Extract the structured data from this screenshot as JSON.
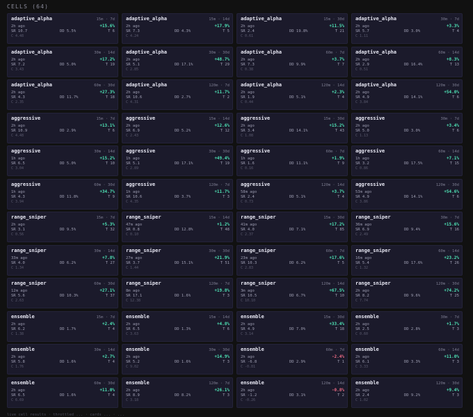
{
  "header": {
    "title": "CELLS (64)"
  },
  "footer": {
    "text": "live cell results · throttled ... · cards ... · ..."
  },
  "cells": [
    {
      "name": "adaptive_alpha",
      "tf": "15m · 7d",
      "ago": "2h ago",
      "ret": "+15.6%",
      "sr": "SR 10.7",
      "dd": "DD 5.5%",
      "t": "T 6",
      "c": "C 4.48",
      "sign": "pos"
    },
    {
      "name": "adaptive_alpha",
      "tf": "15m · 14d",
      "ago": "2h ago",
      "ret": "+17.9%",
      "sr": "SR 7.3",
      "dd": "DD 4.3%",
      "t": "T 5",
      "c": "C 4.24",
      "sign": "pos"
    },
    {
      "name": "adaptive_alpha",
      "tf": "15m · 30d",
      "ago": "2h ago",
      "ret": "+11.5%",
      "sr": "SR 2.4",
      "dd": "DD 19.8%",
      "t": "T 21",
      "c": "C 0.61",
      "sign": "pos"
    },
    {
      "name": "adaptive_alpha",
      "tf": "30m · 7d",
      "ago": "2h ago",
      "ret": "+3.3%",
      "sr": "SR 5.7",
      "dd": "DD 3.0%",
      "t": "T 4",
      "c": "C 1.11",
      "sign": "pos"
    },
    {
      "name": "adaptive_alpha",
      "tf": "30m · 14d",
      "ago": "2h ago",
      "ret": "+17.2%",
      "sr": "SR 7.2",
      "dd": "DD 5.0%",
      "t": "T 19",
      "c": "C 3.43",
      "sign": "pos"
    },
    {
      "name": "adaptive_alpha",
      "tf": "30m · 30d",
      "ago": "2h ago",
      "ret": "+48.7%",
      "sr": "SR 5.1",
      "dd": "DD 17.1%",
      "t": "T 29",
      "c": "C 2.85",
      "sign": "pos"
    },
    {
      "name": "adaptive_alpha",
      "tf": "60m · 7d",
      "ago": "2h ago",
      "ret": "+3.7%",
      "sr": "SR 7.3",
      "dd": "DD 9.9%",
      "t": "T 7",
      "c": "C 0.38",
      "sign": "pos"
    },
    {
      "name": "adaptive_alpha",
      "tf": "60m · 14d",
      "ago": "2h ago",
      "ret": "+8.3%",
      "sr": "SR 2.9",
      "dd": "DD 16.4%",
      "t": "T 13",
      "c": "C 0.51",
      "sign": "pos"
    },
    {
      "name": "adaptive_alpha",
      "tf": "60m · 30d",
      "ago": "2h ago",
      "ret": "+27.3%",
      "sr": "SR 4.3",
      "dd": "DD 11.7%",
      "t": "T 18",
      "c": "C 2.35",
      "sign": "pos"
    },
    {
      "name": "adaptive_alpha",
      "tf": "120m · 7d",
      "ago": "2h ago",
      "ret": "+11.7%",
      "sr": "SR 10.6",
      "dd": "DD 2.7%",
      "t": "T 2",
      "c": "C 4.31",
      "sign": "pos"
    },
    {
      "name": "adaptive_alpha",
      "tf": "120m · 14d",
      "ago": "2h ago",
      "ret": "+2.3%",
      "sr": "SR 1.9",
      "dd": "DD 5.1%",
      "t": "T 4",
      "c": "C 0.44",
      "sign": "pos"
    },
    {
      "name": "adaptive_alpha",
      "tf": "120m · 30d",
      "ago": "2h ago",
      "ret": "+54.0%",
      "sr": "SR 4.9",
      "dd": "DD 14.1%",
      "t": "T 6",
      "c": "C 3.84",
      "sign": "pos"
    },
    {
      "name": "aggressive",
      "tf": "15m · 7d",
      "ago": "2h ago",
      "ret": "+13.1%",
      "sr": "SR 10.9",
      "dd": "DD 2.9%",
      "t": "T 6",
      "c": "C 4.48",
      "sign": "pos"
    },
    {
      "name": "aggressive",
      "tf": "15m · 14d",
      "ago": "2h ago",
      "ret": "+12.6%",
      "sr": "SR 6.9",
      "dd": "DD 5.2%",
      "t": "T 12",
      "c": "C 2.43",
      "sign": "pos"
    },
    {
      "name": "aggressive",
      "tf": "15m · 30d",
      "ago": "2h ago",
      "ret": "+15.2%",
      "sr": "SR 3.4",
      "dd": "DD 14.1%",
      "t": "T 43",
      "c": "C 1.08",
      "sign": "pos"
    },
    {
      "name": "aggressive",
      "tf": "30m · 7d",
      "ago": "2h ago",
      "ret": "+3.4%",
      "sr": "SR 5.0",
      "dd": "DD 3.0%",
      "t": "T 6",
      "c": "C 1.13",
      "sign": "pos"
    },
    {
      "name": "aggressive",
      "tf": "30m · 14d",
      "ago": "1h ago",
      "ret": "+15.2%",
      "sr": "SR 6.5",
      "dd": "DD 5.0%",
      "t": "T 10",
      "c": "C 3.04",
      "sign": "pos"
    },
    {
      "name": "aggressive",
      "tf": "30m · 30d",
      "ago": "1h ago",
      "ret": "+49.4%",
      "sr": "SR 5.1",
      "dd": "DD 17.1%",
      "t": "T 19",
      "c": "C 2.89",
      "sign": "pos"
    },
    {
      "name": "aggressive",
      "tf": "60m · 7d",
      "ago": "1h ago",
      "ret": "+1.9%",
      "sr": "SR 1.6",
      "dd": "DD 11.1%",
      "t": "T 9",
      "c": "C 0.16",
      "sign": "pos"
    },
    {
      "name": "aggressive",
      "tf": "60m · 14d",
      "ago": "1h ago",
      "ret": "+7.1%",
      "sr": "SR 3.2",
      "dd": "DD 17.5%",
      "t": "T 15",
      "c": "C 0.86",
      "sign": "pos"
    },
    {
      "name": "aggressive",
      "tf": "60m · 30d",
      "ago": "1h ago",
      "ret": "+34.7%",
      "sr": "SR 4.3",
      "dd": "DD 11.8%",
      "t": "T 9",
      "c": "C 3.94",
      "sign": "pos"
    },
    {
      "name": "aggressive",
      "tf": "120m · 7d",
      "ago": "1h ago",
      "ret": "+11.7%",
      "sr": "SR 10.6",
      "dd": "DD 3.7%",
      "t": "T 3",
      "c": "C 4.35",
      "sign": "pos"
    },
    {
      "name": "aggressive",
      "tf": "120m · 14d",
      "ago": "58m ago",
      "ret": "+3.7%",
      "sr": "SR 2.4",
      "dd": "DD 5.1%",
      "t": "T 4",
      "c": "C 0.73",
      "sign": "pos"
    },
    {
      "name": "aggressive",
      "tf": "120m · 30d",
      "ago": "53m ago",
      "ret": "+54.6%",
      "sr": "SR 4.9",
      "dd": "DD 14.1%",
      "t": "T 6",
      "c": "C 3.86",
      "sign": "pos"
    },
    {
      "name": "range_sniper",
      "tf": "15m · 7d",
      "ago": "2h ago",
      "ret": "+5.3%",
      "sr": "SR 3.1",
      "dd": "DD 9.5%",
      "t": "T 32",
      "c": "C 0.56",
      "sign": "pos"
    },
    {
      "name": "range_sniper",
      "tf": "15m · 14d",
      "ago": "47m ago",
      "ret": "+1.2%",
      "sr": "SR 0.8",
      "dd": "DD 12.8%",
      "t": "T 48",
      "c": "C 0.10",
      "sign": "pos"
    },
    {
      "name": "range_sniper",
      "tf": "15m · 30d",
      "ago": "41m ago",
      "ret": "+17.2%",
      "sr": "SR 4.0",
      "dd": "DD 7.1%",
      "t": "T 85",
      "c": "C 2.37",
      "sign": "pos"
    },
    {
      "name": "range_sniper",
      "tf": "30m · 7d",
      "ago": "36m ago",
      "ret": "+15.6%",
      "sr": "SR 6.9",
      "dd": "DD 9.4%",
      "t": "T 16",
      "c": "C 2.49",
      "sign": "pos"
    },
    {
      "name": "range_sniper",
      "tf": "30m · 14d",
      "ago": "33m ago",
      "ret": "+7.8%",
      "sr": "SR 4.0",
      "dd": "DD 6.2%",
      "t": "T 27",
      "c": "C 1.34",
      "sign": "pos"
    },
    {
      "name": "range_sniper",
      "tf": "30m · 30d",
      "ago": "27m ago",
      "ret": "+21.9%",
      "sr": "SR 3.7",
      "dd": "DD 15.1%",
      "t": "T 51",
      "c": "C 1.44",
      "sign": "pos"
    },
    {
      "name": "range_sniper",
      "tf": "60m · 7d",
      "ago": "23m ago",
      "ret": "+17.6%",
      "sr": "SR 10.3",
      "dd": "DD 6.2%",
      "t": "T 5",
      "c": "C 2.83",
      "sign": "pos"
    },
    {
      "name": "range_sniper",
      "tf": "60m · 14d",
      "ago": "16m ago",
      "ret": "+23.2%",
      "sr": "SR 5.4",
      "dd": "DD 17.6%",
      "t": "T 26",
      "c": "C 1.32",
      "sign": "pos"
    },
    {
      "name": "range_sniper",
      "tf": "60m · 30d",
      "ago": "12m ago",
      "ret": "+27.1%",
      "sr": "SR 5.6",
      "dd": "DD 10.3%",
      "t": "T 37",
      "c": "C 2.63",
      "sign": "pos"
    },
    {
      "name": "range_sniper",
      "tf": "120m · 7d",
      "ago": "8m ago",
      "ret": "+19.8%",
      "sr": "SR 17.1",
      "dd": "DD 1.6%",
      "t": "T 3",
      "c": "C 12.38",
      "sign": "pos"
    },
    {
      "name": "range_sniper",
      "tf": "120m · 14d",
      "ago": "3m ago",
      "ret": "+67.5%",
      "sr": "SR 10.5",
      "dd": "DD 6.7%",
      "t": "T 10",
      "c": "C 10.10",
      "sign": "pos"
    },
    {
      "name": "range_sniper",
      "tf": "120m · 30d",
      "ago": "2h ago",
      "ret": "+74.2%",
      "sr": "SR 8.2",
      "dd": "DD 9.6%",
      "t": "T 25",
      "c": "C 7.74",
      "sign": "pos"
    },
    {
      "name": "ensemble",
      "tf": "15m · 7d",
      "ago": "2h ago",
      "ret": "+2.4%",
      "sr": "SR 6.2",
      "dd": "DD 1.7%",
      "t": "T 4",
      "c": "C 1.38",
      "sign": "pos"
    },
    {
      "name": "ensemble",
      "tf": "15m · 14d",
      "ago": "2h ago",
      "ret": "+4.8%",
      "sr": "SR 6.5",
      "dd": "DD 1.3%",
      "t": "T 6",
      "c": "C 3.63",
      "sign": "pos"
    },
    {
      "name": "ensemble",
      "tf": "15m · 30d",
      "ago": "2h ago",
      "ret": "+33.4%",
      "sr": "SR 4.9",
      "dd": "DD 7.0%",
      "t": "T 18",
      "c": "C 3.14",
      "sign": "pos"
    },
    {
      "name": "ensemble",
      "tf": "30m · 7d",
      "ago": "2h ago",
      "ret": "+1.7%",
      "sr": "SR 2.5",
      "dd": "DD 2.8%",
      "t": "T 3",
      "c": "C 0.60",
      "sign": "pos"
    },
    {
      "name": "ensemble",
      "tf": "30m · 14d",
      "ago": "2h ago",
      "ret": "+2.7%",
      "sr": "SR 5.8",
      "dd": "DD 1.6%",
      "t": "T 4",
      "c": "C 1.76",
      "sign": "pos"
    },
    {
      "name": "ensemble",
      "tf": "30m · 30d",
      "ago": "2h ago",
      "ret": "+14.9%",
      "sr": "SR 5.2",
      "dd": "DD 1.6%",
      "t": "T 3",
      "c": "C 9.02",
      "sign": "pos"
    },
    {
      "name": "ensemble",
      "tf": "60m · 7d",
      "ago": "2h ago",
      "ret": "-2.4%",
      "sr": "SR -6.8",
      "dd": "DD 2.9%",
      "t": "T 1",
      "c": "C -0.81",
      "sign": "neg"
    },
    {
      "name": "ensemble",
      "tf": "60m · 14d",
      "ago": "2h ago",
      "ret": "+11.0%",
      "sr": "SR 6.1",
      "dd": "DD 3.3%",
      "t": "T 3",
      "c": "C 3.33",
      "sign": "pos"
    },
    {
      "name": "ensemble",
      "tf": "60m · 30d",
      "ago": "2h ago",
      "ret": "+11.0%",
      "sr": "SR 6.5",
      "dd": "DD 1.6%",
      "t": "T 4",
      "c": "C 6.69",
      "sign": "pos"
    },
    {
      "name": "ensemble",
      "tf": "120m · 7d",
      "ago": "2h ago",
      "ret": "+26.1%",
      "sr": "SR 8.9",
      "dd": "DD 8.2%",
      "t": "T 3",
      "c": "C 3.18",
      "sign": "pos"
    },
    {
      "name": "ensemble",
      "tf": "120m · 14d",
      "ago": "2h ago",
      "ret": "-0.8%",
      "sr": "SR -1.2",
      "dd": "DD 3.1%",
      "t": "T 2",
      "c": "C -0.26",
      "sign": "neg"
    },
    {
      "name": "ensemble",
      "tf": "120m · 30d",
      "ago": "2h ago",
      "ret": "+9.4%",
      "sr": "SR 2.4",
      "dd": "DD 9.2%",
      "t": "T 3",
      "c": "C 1.02",
      "sign": "pos"
    }
  ]
}
